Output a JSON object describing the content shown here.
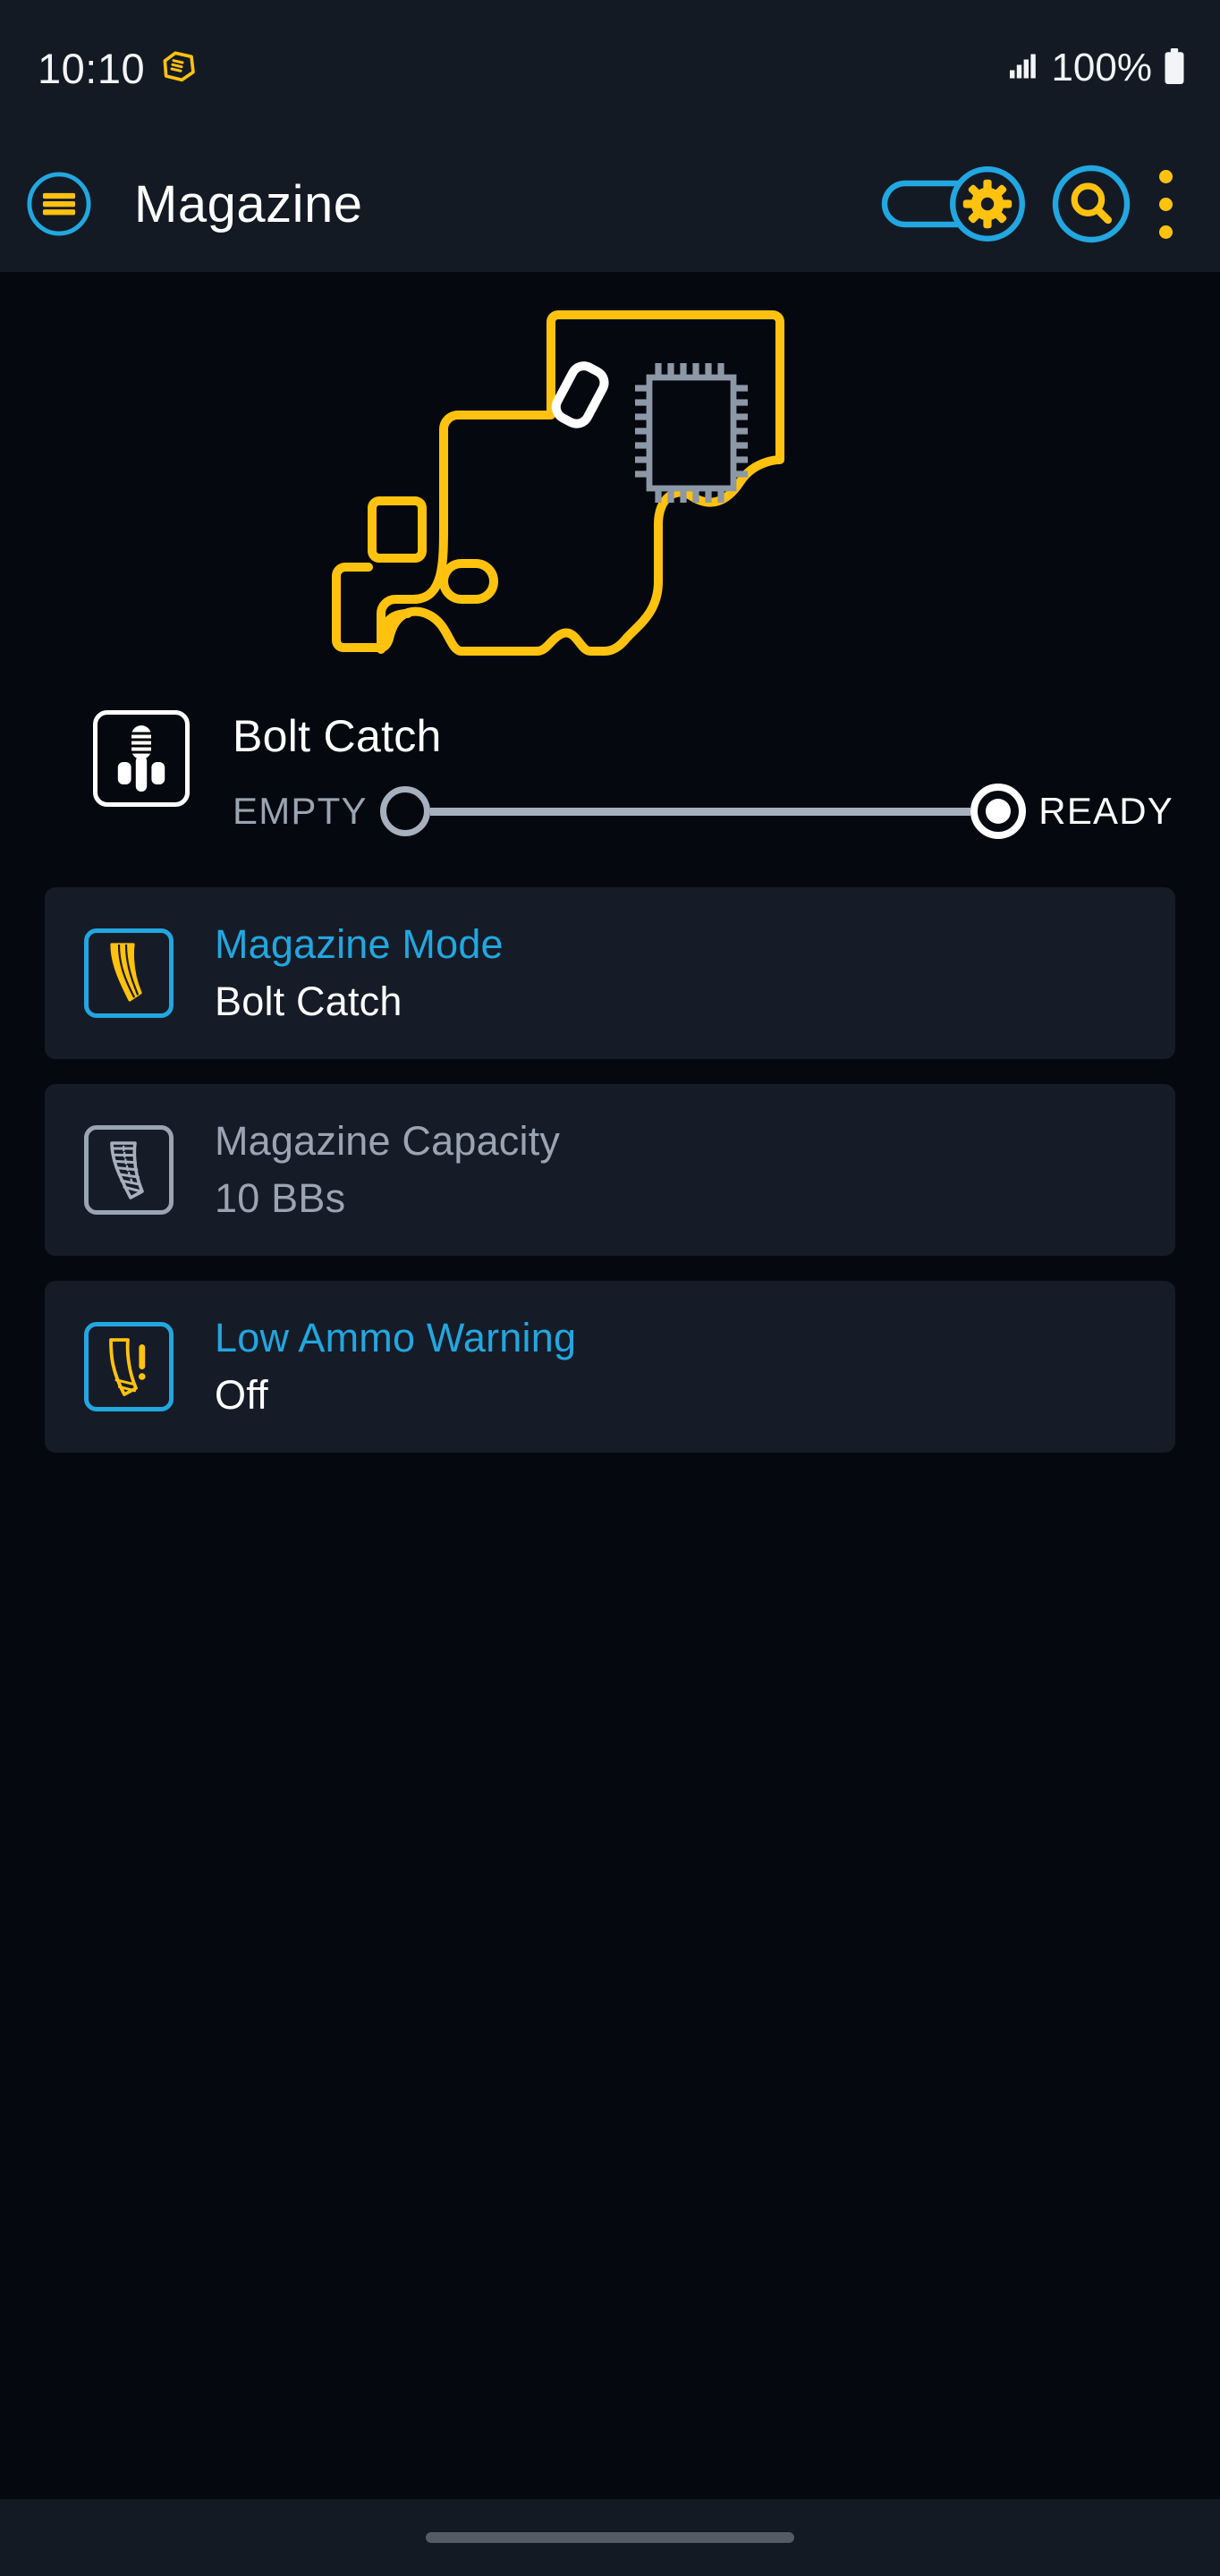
{
  "status_bar": {
    "time": "10:10",
    "app_notification_icon": "hexagon-chip-icon",
    "signal_icon": "cellular-signal-icon",
    "battery_percent": "100%",
    "battery_icon": "battery-full-icon"
  },
  "app_bar": {
    "menu_icon": "hamburger-menu-icon",
    "title": "Magazine",
    "settings_toggle_icon": "gear-toggle-icon",
    "search_icon": "search-icon",
    "overflow_icon": "more-vertical-icon"
  },
  "hero": {
    "image_name": "pcb-board-outline-illustration",
    "outline_color": "#ffc20e",
    "chip_color": "#8d98a7",
    "component_color": "#ffffff"
  },
  "bolt_catch": {
    "icon": "bolt-catch-icon",
    "title": "Bolt Catch",
    "slider": {
      "left_label": "EMPTY",
      "right_label": "READY",
      "selected": "READY"
    }
  },
  "settings": [
    {
      "icon": "magazine-icon",
      "title": "Magazine Mode",
      "value": "Bolt Catch",
      "enabled": true
    },
    {
      "icon": "magazine-rounds-icon",
      "title": "Magazine Capacity",
      "value": "10 BBs",
      "enabled": false
    },
    {
      "icon": "magazine-warning-icon",
      "title": "Low Ammo Warning",
      "value": "Off",
      "enabled": true
    }
  ],
  "nav_bar": {
    "gesture_handle": "home-gesture-pill"
  },
  "colors": {
    "accent_cyan": "#22a7e0",
    "accent_yellow": "#ffc20e",
    "card_bg": "#161c27",
    "page_bg": "#05080f",
    "bar_bg": "#141a24",
    "muted": "#9aa4b2"
  }
}
